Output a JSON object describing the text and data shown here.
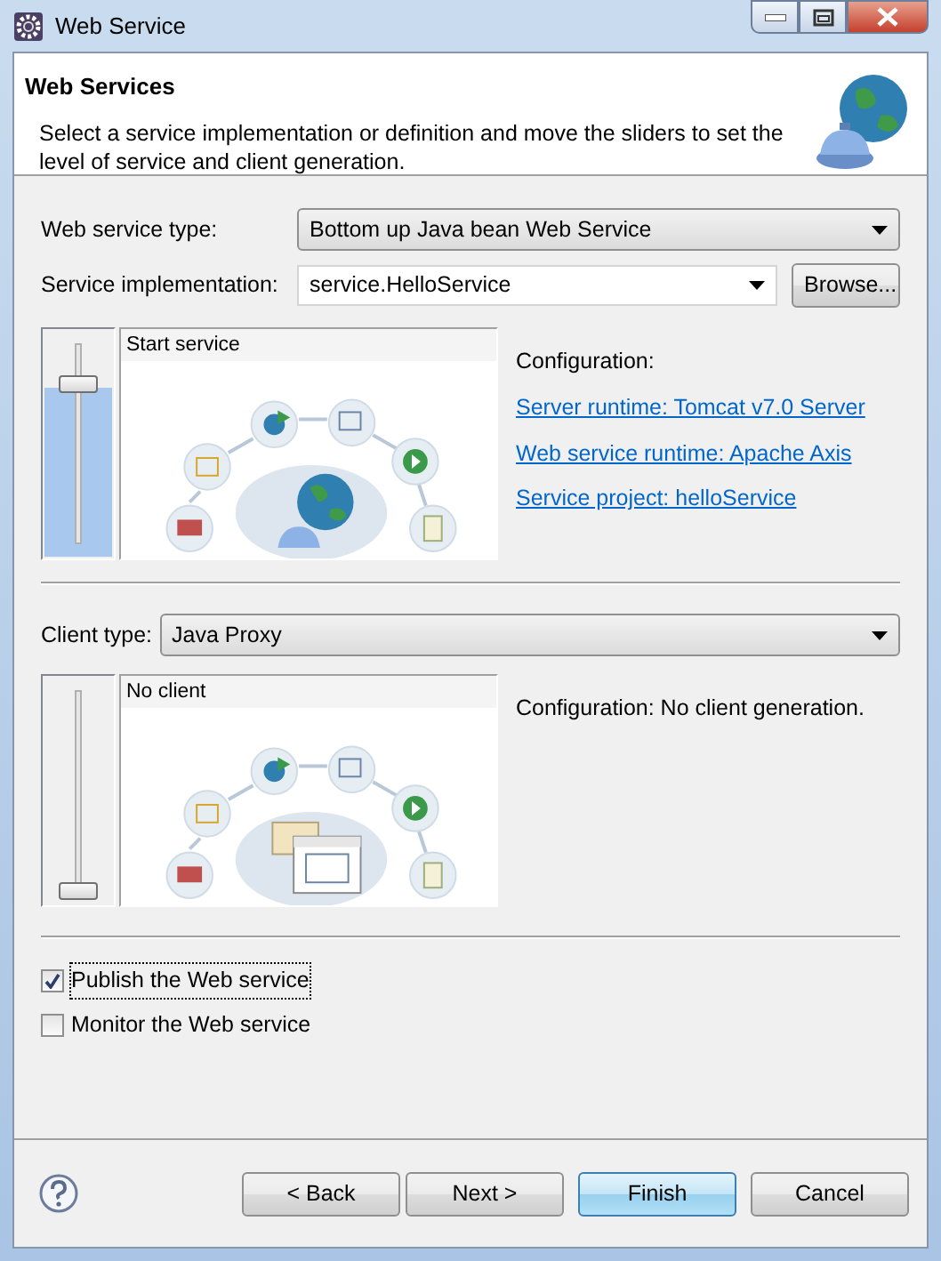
{
  "window": {
    "title": "Web Service"
  },
  "header": {
    "title": "Web Services",
    "description": "Select a service implementation or definition and move the sliders to set the level of service and client generation."
  },
  "service": {
    "type_label": "Web service type:",
    "type_value": "Bottom up Java bean Web Service",
    "implementation_label": "Service implementation:",
    "implementation_value": "service.HelloService",
    "browse_button": "Browse...",
    "slider": {
      "level": 0.83
    },
    "stage": {
      "kind": "service",
      "label": "Start service"
    },
    "configuration_label": "Configuration:",
    "links": [
      "Server runtime: Tomcat v7.0 Server",
      "Web service runtime: Apache Axis",
      "Service project: helloService"
    ]
  },
  "client": {
    "type_label": "Client type:",
    "type_value": "Java Proxy",
    "slider": {
      "level": 0
    },
    "stage": {
      "kind": "client",
      "label": "No client"
    },
    "configuration": "Configuration: No client generation."
  },
  "options": [
    {
      "label": "Publish the Web service",
      "checked": true,
      "focused": true
    },
    {
      "label": "Monitor the Web service",
      "checked": false,
      "focused": false
    }
  ],
  "buttons": [
    {
      "label": "< Back",
      "default": false
    },
    {
      "label": "Next >",
      "default": false
    },
    {
      "label": "Finish",
      "default": true
    },
    {
      "label": "Cancel",
      "default": false
    }
  ]
}
